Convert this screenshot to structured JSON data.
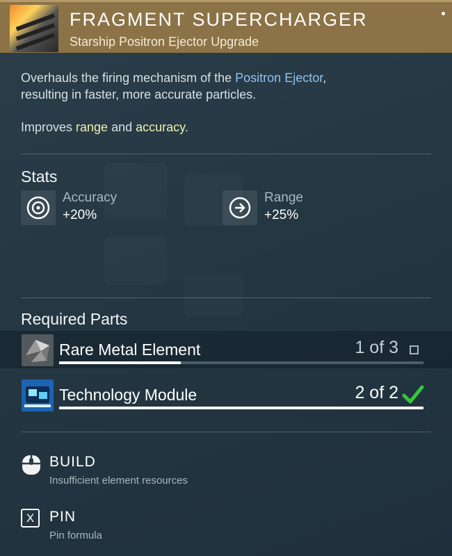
{
  "header": {
    "title": "FRAGMENT SUPERCHARGER",
    "subtitle": "Starship Positron Ejector Upgrade"
  },
  "description": {
    "line1_before": "Overhauls the firing mechanism of the ",
    "link": "Positron Ejector",
    "line1_after": ",",
    "line2": "resulting in faster, more accurate particles.",
    "improves_prefix": "Improves ",
    "improves_hl1": "range",
    "improves_mid": " and ",
    "improves_hl2": "accuracy",
    "improves_suffix": "."
  },
  "stats": {
    "title": "Stats",
    "items": [
      {
        "label": "Accuracy",
        "value": "+20%",
        "icon": "target-icon"
      },
      {
        "label": "Range",
        "value": "+25%",
        "icon": "arrow-right-circle-icon"
      }
    ]
  },
  "parts": {
    "title": "Required Parts",
    "items": [
      {
        "name": "Rare Metal Element",
        "count": "1 of 3",
        "have": 1,
        "need": 3,
        "complete": false,
        "icon": "rare-metal-icon"
      },
      {
        "name": "Technology Module",
        "count": "2 of 2",
        "have": 2,
        "need": 2,
        "complete": true,
        "icon": "tech-module-icon"
      }
    ]
  },
  "actions": [
    {
      "label": "BUILD",
      "sub": "Insufficient element resources",
      "icon": "mouse-icon"
    },
    {
      "label": "PIN",
      "sub": "Pin formula",
      "key": "X"
    }
  ],
  "colors": {
    "header_bg": "#8b7347",
    "link": "#8fc4f2",
    "highlight": "#f1f0b0",
    "check_green": "#35c83a"
  }
}
